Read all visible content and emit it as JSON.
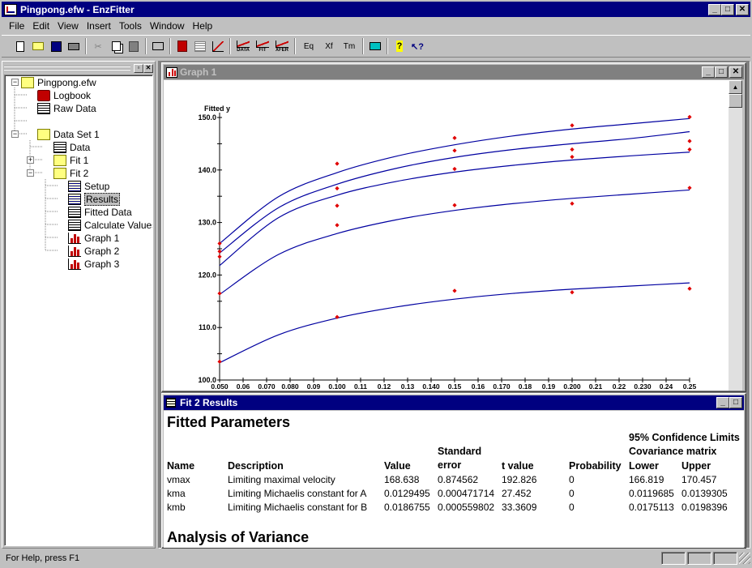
{
  "app": {
    "title": "Pingpong.efw - EnzFitter"
  },
  "menu": [
    "File",
    "Edit",
    "View",
    "Insert",
    "Tools",
    "Window",
    "Help"
  ],
  "toolbar": {
    "eq": "Eq",
    "xf": "Xf",
    "tm": "Tm",
    "data_caption": "DATA",
    "fit_caption": "FIT",
    "xfer_caption": "XFER"
  },
  "tree": {
    "root": "Pingpong.efw",
    "logbook": "Logbook",
    "raw_data": "Raw Data",
    "data_set": "Data Set 1",
    "data": "Data",
    "fit1": "Fit 1",
    "fit2": "Fit 2",
    "setup": "Setup",
    "results": "Results",
    "fitted_data": "Fitted Data",
    "calc_values": "Calculate Values",
    "graph1": "Graph 1",
    "graph2": "Graph 2",
    "graph3": "Graph 3"
  },
  "graph_window": {
    "title": "Graph 1"
  },
  "results_window": {
    "title": "Fit 2 Results"
  },
  "results": {
    "heading": "Fitted Parameters",
    "conf_header": "95% Confidence Limits",
    "cov_header": "Covariance matrix",
    "std_header1": "Standard",
    "columns": {
      "name": "Name",
      "desc": "Description",
      "value": "Value",
      "stderr": "error",
      "t": "t value",
      "prob": "Probability",
      "lower": "Lower",
      "upper": "Upper"
    },
    "rows": [
      {
        "name": "vmax",
        "desc": "Limiting maximal velocity",
        "value": "168.638",
        "stderr": "0.874562",
        "t": "192.826",
        "prob": "0",
        "lower": "166.819",
        "upper": "170.457"
      },
      {
        "name": "kma",
        "desc": "Limiting Michaelis constant for A",
        "value": "0.0129495",
        "stderr": "0.000471714",
        "t": "27.452",
        "prob": "0",
        "lower": "0.0119685",
        "upper": "0.0139305"
      },
      {
        "name": "kmb",
        "desc": "Limiting Michaelis constant for B",
        "value": "0.0186755",
        "stderr": "0.000559802",
        "t": "33.3609",
        "prob": "0",
        "lower": "0.0175113",
        "upper": "0.0198396"
      }
    ],
    "anova_heading": "Analysis of Variance"
  },
  "status": {
    "text": "For Help, press F1"
  },
  "chart_data": {
    "type": "scatter",
    "ylabel": "Fitted y",
    "ylim": [
      100,
      150
    ],
    "xlim": [
      0.05,
      0.25
    ],
    "yticks": [
      "100.0",
      "110.0",
      "120.0",
      "130.0",
      "140.0",
      "150.0"
    ],
    "xticks": [
      "0.050",
      "0.06",
      "0.070",
      "0.080",
      "0.09",
      "0.100",
      "0.11",
      "0.12",
      "0.13",
      "0.140",
      "0.15",
      "0.16",
      "0.170",
      "0.18",
      "0.19",
      "0.200",
      "0.21",
      "0.22",
      "0.230",
      "0.24",
      "0.25"
    ],
    "points": [
      [
        0.05,
        103.5
      ],
      [
        0.05,
        116.5
      ],
      [
        0.05,
        123.5
      ],
      [
        0.05,
        124.5
      ],
      [
        0.05,
        126
      ],
      [
        0.1,
        112
      ],
      [
        0.1,
        129.5
      ],
      [
        0.1,
        133.2
      ],
      [
        0.1,
        136.5
      ],
      [
        0.1,
        141.2
      ],
      [
        0.15,
        117
      ],
      [
        0.15,
        133.3
      ],
      [
        0.15,
        140.2
      ],
      [
        0.15,
        143.7
      ],
      [
        0.15,
        146.1
      ],
      [
        0.2,
        116.7
      ],
      [
        0.2,
        133.6
      ],
      [
        0.2,
        142.5
      ],
      [
        0.2,
        143.9
      ],
      [
        0.2,
        148.5
      ],
      [
        0.25,
        117.4
      ],
      [
        0.25,
        136.6
      ],
      [
        0.25,
        143.9
      ],
      [
        0.25,
        145.5
      ],
      [
        0.25,
        150.1
      ]
    ],
    "curves": [
      [
        [
          0.05,
          103.3
        ],
        [
          0.075,
          108.6
        ],
        [
          0.1,
          111.8
        ],
        [
          0.125,
          113.9
        ],
        [
          0.15,
          115.4
        ],
        [
          0.175,
          116.5
        ],
        [
          0.2,
          117.3
        ],
        [
          0.225,
          117.9
        ],
        [
          0.25,
          118.5
        ]
      ],
      [
        [
          0.05,
          116.3
        ],
        [
          0.075,
          123.9
        ],
        [
          0.1,
          127.9
        ],
        [
          0.125,
          130.5
        ],
        [
          0.15,
          132.3
        ],
        [
          0.175,
          133.6
        ],
        [
          0.2,
          134.6
        ],
        [
          0.225,
          135.4
        ],
        [
          0.25,
          136.2
        ]
      ],
      [
        [
          0.05,
          121.8
        ],
        [
          0.075,
          130.9
        ],
        [
          0.1,
          135.2
        ],
        [
          0.125,
          137.8
        ],
        [
          0.15,
          139.6
        ],
        [
          0.175,
          140.9
        ],
        [
          0.2,
          141.9
        ],
        [
          0.225,
          142.7
        ],
        [
          0.25,
          143.4
        ]
      ],
      [
        [
          0.05,
          124.2
        ],
        [
          0.075,
          132.8
        ],
        [
          0.1,
          137.3
        ],
        [
          0.125,
          140.3
        ],
        [
          0.15,
          142.4
        ],
        [
          0.175,
          143.9
        ],
        [
          0.2,
          145
        ],
        [
          0.225,
          146
        ],
        [
          0.25,
          147.3
        ]
      ],
      [
        [
          0.05,
          126
        ],
        [
          0.075,
          134.9
        ],
        [
          0.1,
          139.5
        ],
        [
          0.125,
          142.6
        ],
        [
          0.15,
          144.8
        ],
        [
          0.175,
          146.5
        ],
        [
          0.2,
          147.8
        ],
        [
          0.225,
          148.8
        ],
        [
          0.25,
          149.8
        ]
      ]
    ]
  }
}
